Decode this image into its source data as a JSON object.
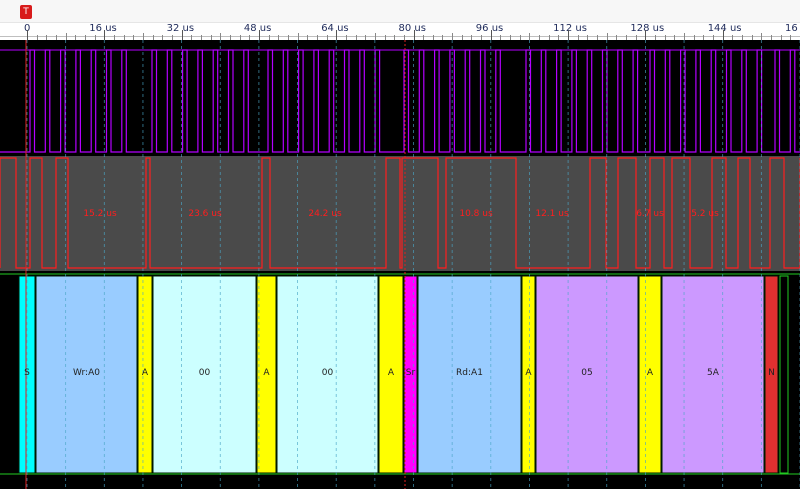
{
  "ruler": {
    "cursor_label": "T",
    "ticks": [
      "0",
      "16 us",
      "32 us",
      "48 us",
      "64 us",
      "80 us",
      "96 us",
      "112 us",
      "128 us",
      "144 us",
      "16"
    ]
  },
  "durations": [
    "15.2 us",
    "23.6 us",
    "24.2 us",
    "10.8 us",
    "12.1 us",
    "6.7 us",
    "5.2 us"
  ],
  "protocol": {
    "labels": [
      "S",
      "Wr:A0",
      "A",
      "00",
      "A",
      "00",
      "A",
      "Sr",
      "Rd:A1",
      "A",
      "05",
      "A",
      "5A",
      "N"
    ]
  },
  "colors": {
    "clock": "#b400ff",
    "duration_trace": "#ff1e1e",
    "start": "#00ffff",
    "address": "#99ccff",
    "data_write": "#ccffff",
    "ack": "#ffff00",
    "repeat_start": "#ff00ff",
    "data_read": "#cc99ff",
    "nack": "#e03030"
  }
}
